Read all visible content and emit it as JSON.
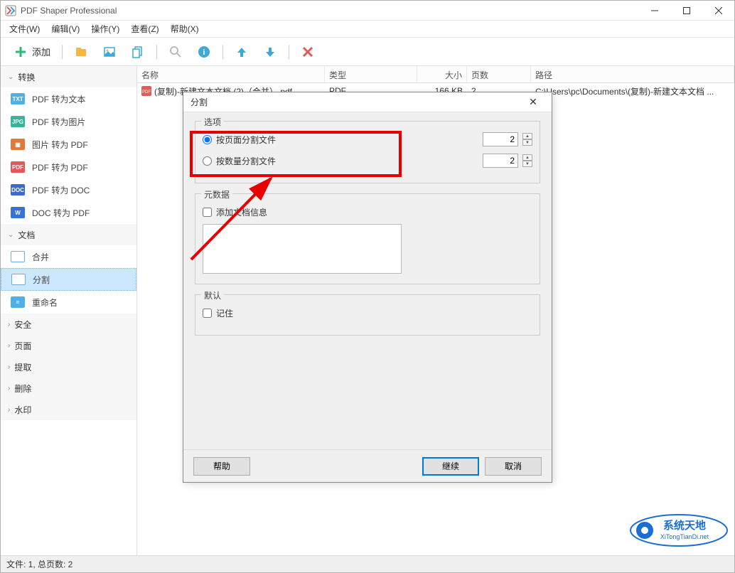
{
  "title": "PDF Shaper Professional",
  "menu": {
    "file": "文件(W)",
    "edit": "编辑(V)",
    "action": "操作(Y)",
    "view": "查看(Z)",
    "help": "帮助(X)"
  },
  "toolbar": {
    "add": "添加"
  },
  "sidebar": {
    "sections": [
      {
        "id": "convert",
        "label": "转换",
        "expanded": true,
        "items": [
          {
            "id": "pdf-to-text",
            "label": "PDF 转为文本",
            "icon_bg": "#4fb0e6",
            "icon_txt": "TXT"
          },
          {
            "id": "pdf-to-image",
            "label": "PDF 转为图片",
            "icon_bg": "#39b39b",
            "icon_txt": "JPG"
          },
          {
            "id": "image-to-pdf",
            "label": "图片 转为 PDF",
            "icon_bg": "#e07a3c",
            "icon_txt": "▣"
          },
          {
            "id": "pdf-to-pdf",
            "label": "PDF 转为 PDF",
            "icon_bg": "#e05a5a",
            "icon_txt": "PDF"
          },
          {
            "id": "pdf-to-doc",
            "label": "PDF 转为 DOC",
            "icon_bg": "#3a6cc8",
            "icon_txt": "DOC"
          },
          {
            "id": "doc-to-pdf",
            "label": "DOC 转为 PDF",
            "icon_bg": "#3573d6",
            "icon_txt": "W"
          }
        ]
      },
      {
        "id": "document",
        "label": "文档",
        "expanded": true,
        "items": [
          {
            "id": "merge",
            "label": "合并",
            "icon_bg": "#ffffff",
            "icon_txt": ""
          },
          {
            "id": "split",
            "label": "分割",
            "icon_bg": "#ffffff",
            "icon_txt": "",
            "selected": true
          },
          {
            "id": "rename",
            "label": "重命名",
            "icon_bg": "#4fb0e6",
            "icon_txt": "="
          }
        ]
      },
      {
        "id": "security",
        "label": "安全",
        "expanded": false
      },
      {
        "id": "page",
        "label": "页面",
        "expanded": false
      },
      {
        "id": "extract",
        "label": "提取",
        "expanded": false
      },
      {
        "id": "delete",
        "label": "删除",
        "expanded": false
      },
      {
        "id": "watermark",
        "label": "水印",
        "expanded": false
      }
    ]
  },
  "list": {
    "headers": {
      "name": "名称",
      "type": "类型",
      "size": "大小",
      "pages": "页数",
      "path": "路径"
    },
    "rows": [
      {
        "name": "(复制)-新建文本文档 (2)（合并）.pdf",
        "type": "PDF",
        "size": "166 KB",
        "pages": "2",
        "path": "C:\\Users\\pc\\Documents\\(复制)-新建文本文档 ..."
      }
    ]
  },
  "dialog": {
    "title": "分割",
    "group_options": "选项",
    "opt_by_page": "按页面分割文件",
    "opt_by_count": "按数量分割文件",
    "val_by_page": "2",
    "val_by_count": "2",
    "group_metadata": "元数据",
    "chk_add_docinfo": "添加文档信息",
    "group_default": "默认",
    "chk_remember": "记住",
    "btn_help": "帮助",
    "btn_continue": "继续",
    "btn_cancel": "取消"
  },
  "status": "文件: 1, 总页数: 2",
  "watermark": {
    "line1": "系统天地",
    "line2": "XiTongTianDi.net"
  }
}
